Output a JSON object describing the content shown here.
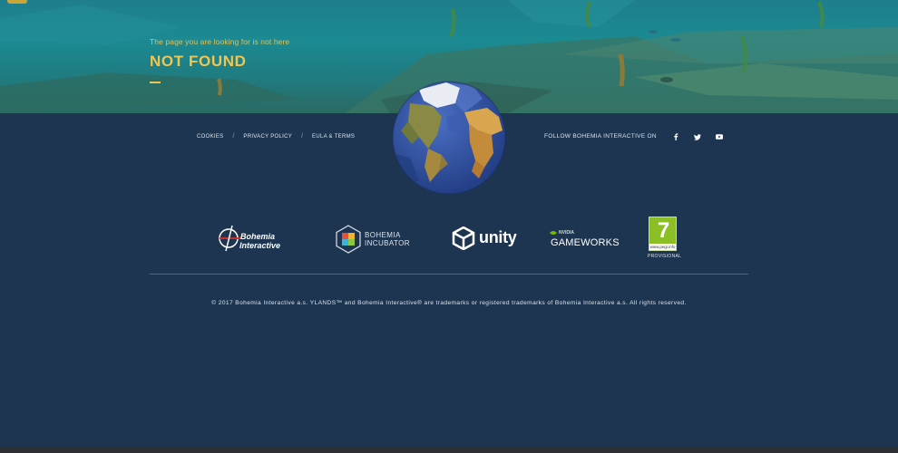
{
  "hero": {
    "subtitle": "The page you are looking for is not here",
    "title": "NOT FOUND"
  },
  "footer_nav": {
    "links": [
      "COOKIES",
      "PRIVACY POLICY",
      "EULA & TERMS"
    ],
    "separator": "/"
  },
  "follow": {
    "label": "FOLLOW BOHEMIA INTERACTIVE ON",
    "icons": [
      "facebook-icon",
      "twitter-icon",
      "youtube-icon"
    ]
  },
  "logos": {
    "bohemia_interactive": {
      "line1": "Bohemia",
      "line2": "Interactive"
    },
    "bohemia_incubator": {
      "line1": "BOHEMIA",
      "line2": "INCUBATOR"
    },
    "unity": {
      "text": "unity"
    },
    "gameworks": {
      "brand": "NVIDIA",
      "text": "GAMEWORKS"
    },
    "pegi": {
      "rating": "7",
      "url": "www.pegi.info",
      "label": "PROVISIONAL"
    }
  },
  "copyright": "© 2017 Bohemia Interactive a.s. YLANDS™ and Bohemia Interactive® are trademarks or registered trademarks of Bohemia Interactive a.s. All rights reserved.",
  "colors": {
    "background": "#1d3550",
    "accent_gold": "#f0c650",
    "text_light": "#dce4ec",
    "pegi_green": "#8cbf26"
  }
}
